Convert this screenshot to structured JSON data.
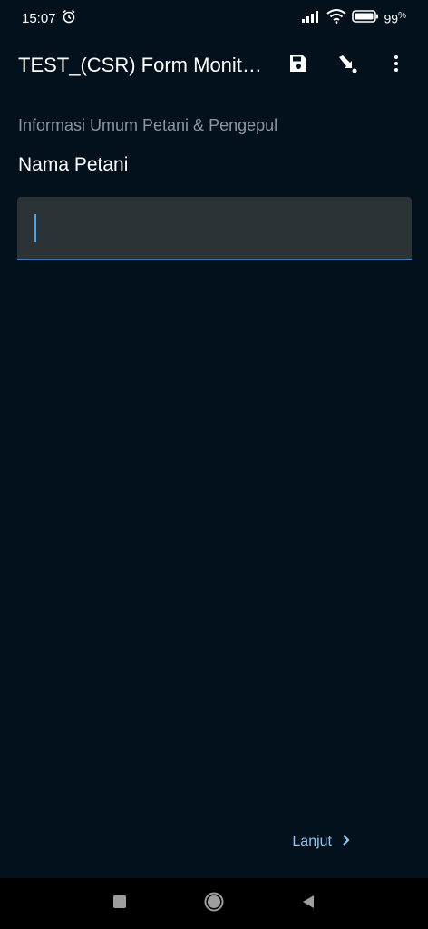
{
  "status_bar": {
    "time": "15:07",
    "battery": "99",
    "battery_unit": "%"
  },
  "app_bar": {
    "title": "TEST_(CSR) Form Monitoring",
    "icons": [
      "save-icon",
      "jump-to-icon",
      "more-vert-icon"
    ]
  },
  "form": {
    "section_title": "Informasi Umum Petani & Pengepul",
    "question_label": "Nama Petani",
    "input_value": "",
    "input_placeholder": ""
  },
  "footer": {
    "next_label": "Lanjut"
  },
  "nav_bar": {
    "icons": [
      "recents-icon",
      "home-icon",
      "back-icon"
    ]
  },
  "colors": {
    "background": "#02111b",
    "input_fill": "#2b3337",
    "accent": "#3a7bb8",
    "link": "#8ec4f2"
  }
}
